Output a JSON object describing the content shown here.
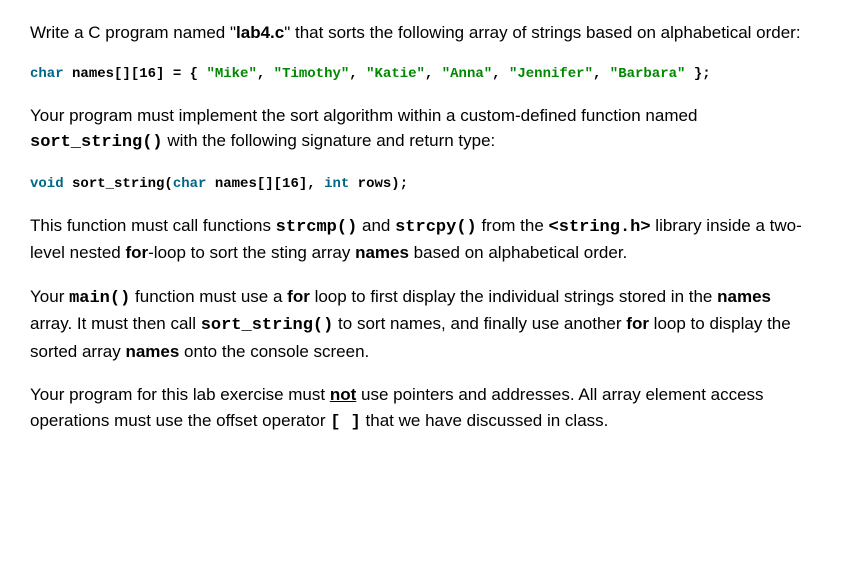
{
  "p1_a": "Write a C program named \"",
  "p1_b": "lab4.c",
  "p1_c": "\" that sorts the following array of strings based on alphabetical order:",
  "code1_pre": "char",
  "code1_mid": " names[][16] = { ",
  "code1_s1": "\"Mike\"",
  "code1_s2": "\"Timothy\"",
  "code1_s3": "\"Katie\"",
  "code1_s4": "\"Anna\"",
  "code1_s5": "\"Jennifer\"",
  "code1_s6": "\"Barbara\"",
  "code1_comma": ", ",
  "code1_end": " };",
  "p2_a": "Your program must implement the sort algorithm within a custom-defined function named ",
  "p2_b": "sort_string()",
  "p2_c": " with the following signature and return type:",
  "code2_void": "void",
  "code2_a": " sort_string(",
  "code2_char": "char",
  "code2_b": " names[][16], ",
  "code2_int": "int",
  "code2_c": " rows);",
  "p3_a": "This function must call functions ",
  "p3_b": "strcmp()",
  "p3_c": " and ",
  "p3_d": "strcpy()",
  "p3_e": " from the ",
  "p3_f": "<string.h>",
  "p3_g": " library inside a two-level nested ",
  "p3_h": "for",
  "p3_i": "-loop to sort the sting array ",
  "p3_j": "names",
  "p3_k": " based on alphabetical order.",
  "p4_a": "Your ",
  "p4_b": "main()",
  "p4_c": " function must use a ",
  "p4_d": "for",
  "p4_e": " loop to first display the individual strings stored in the ",
  "p4_f": "names",
  "p4_g": " array. It must then call ",
  "p4_h": "sort_string()",
  "p4_i": " to sort names, and finally use another ",
  "p4_j": "for",
  "p4_k": " loop to display the sorted array ",
  "p4_l": "names",
  "p4_m": " onto the console screen.",
  "p5_a": "Your program for this lab exercise must ",
  "p5_b": "not",
  "p5_c": " use pointers and addresses. All array element access operations must use the offset operator ",
  "p5_d": "[  ]",
  "p5_e": " that we have discussed in class."
}
